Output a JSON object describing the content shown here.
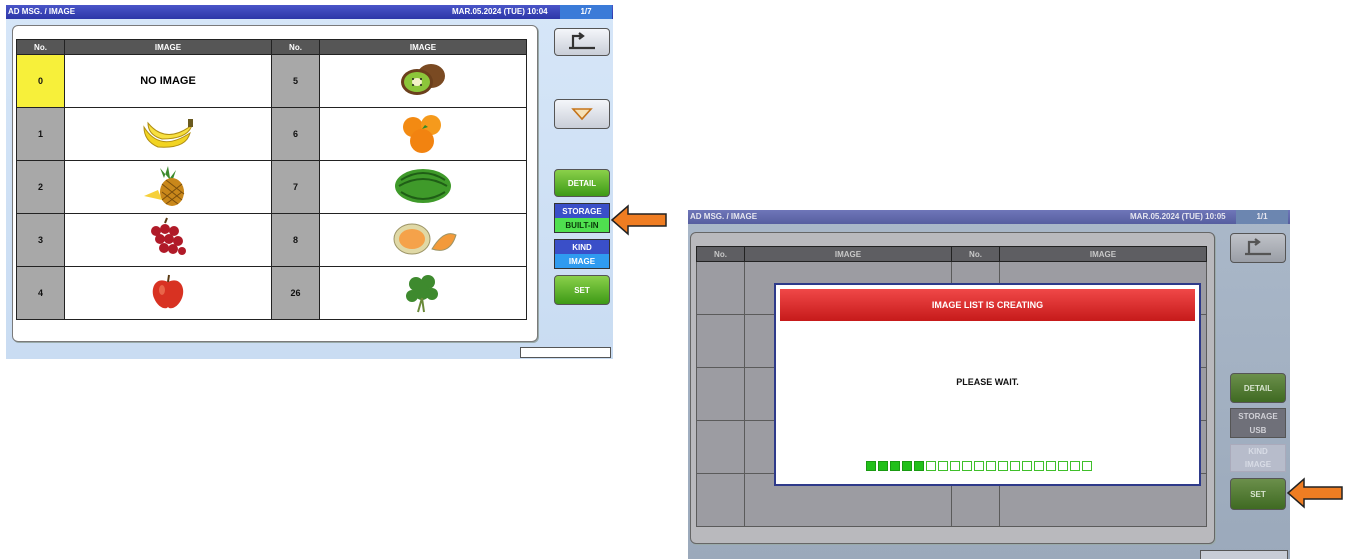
{
  "screen1": {
    "title": "AD MSG. / IMAGE",
    "datetime": "MAR.05.2024 (TUE) 10:04",
    "page": "1/7",
    "headers": [
      "No.",
      "IMAGE",
      "No.",
      "IMAGE"
    ],
    "rows": [
      {
        "left_no": "0",
        "left_img": "NO IMAGE",
        "right_no": "5",
        "right_img": "kiwi-icon"
      },
      {
        "left_no": "1",
        "left_img": "banana-icon",
        "right_no": "6",
        "right_img": "orange-icon"
      },
      {
        "left_no": "2",
        "left_img": "pineapple-icon",
        "right_no": "7",
        "right_img": "watermelon-icon"
      },
      {
        "left_no": "3",
        "left_img": "grapes-icon",
        "right_no": "8",
        "right_img": "melon-icon"
      },
      {
        "left_no": "4",
        "left_img": "apple-icon",
        "right_no": "26",
        "right_img": "herb-icon"
      }
    ],
    "back_icon": "return-arrow-icon",
    "down_icon": "triangle-down-icon",
    "detail_label": "DETAIL",
    "storage_label": "STORAGE",
    "storage_value": "BUILT-IN",
    "kind_label": "KIND",
    "kind_value": "IMAGE",
    "set_label": "SET",
    "selected_no": "0"
  },
  "screen2": {
    "title": "AD MSG. / IMAGE",
    "datetime": "MAR.05.2024 (TUE) 10:05",
    "page": "1/1",
    "headers": [
      "No.",
      "IMAGE",
      "No.",
      "IMAGE"
    ],
    "detail_label": "DETAIL",
    "storage_label": "STORAGE",
    "storage_value": "USB",
    "kind_label": "KIND",
    "kind_value": "IMAGE",
    "set_label": "SET",
    "modal_title": "IMAGE LIST IS CREATING",
    "modal_message": "PLEASE WAIT.",
    "progress": {
      "filled": 5,
      "total": 19
    }
  },
  "colors": {
    "titlebar": "#2c36a8",
    "selected": "#f7f03a",
    "green_button": "#3d9a16",
    "modal_header": "#d42525",
    "callout_arrow": "#ef7d22"
  }
}
